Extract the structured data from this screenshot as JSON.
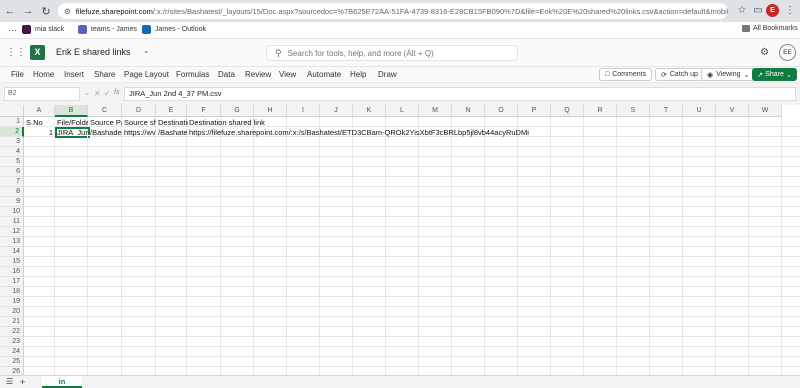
{
  "browser": {
    "url_host": "filefuze.sharepoint.com",
    "url_rest": "/:x:/r/sites/Bashatest/_layouts/15/Doc.aspx?sourcedoc=%7B625E72AA-51FA-4739-8316-E28CB15FB090%7D&file=Erik%20E%20shared%20links.csv&action=default&mobile...",
    "profile_initial": "E",
    "bookmarks": [
      "mia slack",
      "teams - James",
      "James - Outlook"
    ],
    "all_bookmarks": "All Bookmarks"
  },
  "app": {
    "file_title": "Erik E shared links",
    "search_placeholder": "Search for tools, help, and more (Alt + Q)",
    "avatar_initials": "EE"
  },
  "ribbon": {
    "tabs": [
      "File",
      "Home",
      "Insert",
      "Share",
      "Page Layout",
      "Formulas",
      "Data",
      "Review",
      "View",
      "Automate",
      "Help",
      "Draw"
    ],
    "comments": "Comments",
    "catch_up": "Catch up",
    "viewing": "Viewing",
    "share": "Share"
  },
  "formula_bar": {
    "name_box": "B2",
    "fx": "fx",
    "content": "JIRA_Jun 2nd 4_37 PM.csv"
  },
  "grid": {
    "columns": [
      "A",
      "B",
      "C",
      "D",
      "E",
      "F",
      "G",
      "H",
      "I",
      "J",
      "K",
      "L",
      "M",
      "N",
      "O",
      "P",
      "Q",
      "R",
      "S",
      "T",
      "U",
      "V",
      "W"
    ],
    "rows": [
      "1",
      "2",
      "3",
      "4",
      "5",
      "6",
      "7",
      "8",
      "9",
      "10",
      "11",
      "12",
      "13",
      "14",
      "15",
      "16",
      "17",
      "18",
      "19",
      "20",
      "21",
      "22",
      "23",
      "24",
      "25",
      "26"
    ],
    "row1": {
      "a": "S.No",
      "b": "File/Folder",
      "c": "Source Pat",
      "d": "Source sha",
      "e": "Destinatio",
      "f": "Destination shared link"
    },
    "row2": {
      "a": "1",
      "b": "JIRA_Jun 2",
      "c": "/Bashadel",
      "d": "https://wv",
      "e": "/Bashatest",
      "f": "https://filefuze.sharepoint.com/:x:/s/Bashatest/ETD3CBam-QROk2YisXbtF3cBRLbp5jl8vb44acyRuDMiWg"
    }
  },
  "sheet_tab": "in",
  "colors": {
    "excel_green": "#217346",
    "share_green": "#107c41",
    "selection": "#107c41",
    "profile_red": "#c42b1c"
  }
}
